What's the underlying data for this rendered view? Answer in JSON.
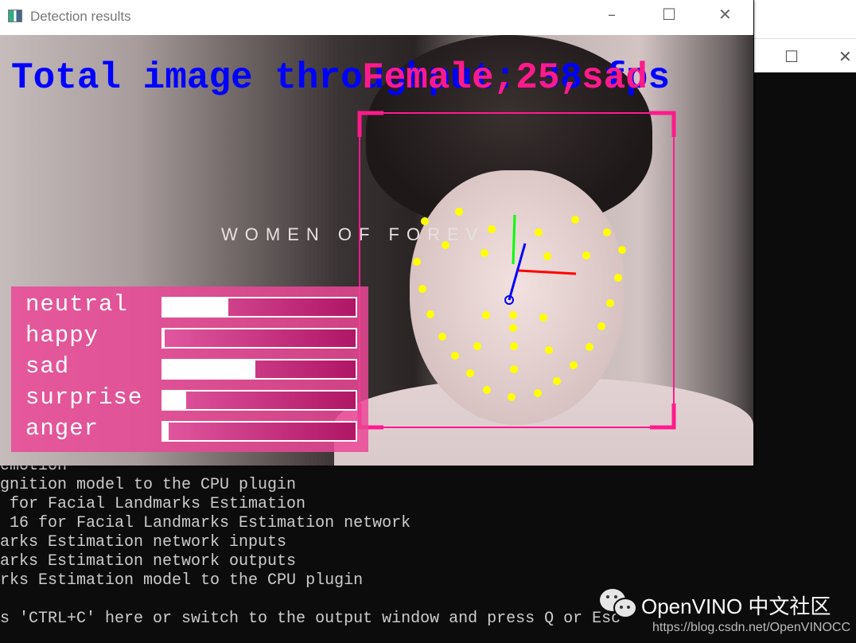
{
  "detection_window": {
    "title": "Detection results",
    "minimize": "–",
    "maximize": "☐",
    "close": "✕",
    "overlay_text": "Total image throughput: 38 fps",
    "face_label": "Female,25,sad",
    "scene_caption": "WOMEN OF FOREV",
    "emotions": [
      {
        "label": "neutral",
        "value": 0.34
      },
      {
        "label": "happy",
        "value": 0.01
      },
      {
        "label": "sad",
        "value": 0.48
      },
      {
        "label": "surprise",
        "value": 0.12
      },
      {
        "label": "anger",
        "value": 0.03
      }
    ],
    "colors": {
      "fps_text": "#0000ff",
      "face_box": "#ff1a8c",
      "landmarks": "#ffff00",
      "panel": "#eb4696"
    }
  },
  "console_window": {
    "maximize": "☐",
    "close": "✕",
    "lines": [
      "emotion",
      "gnition model to the CPU plugin",
      " for Facial Landmarks Estimation",
      " 16 for Facial Landmarks Estimation network",
      "arks Estimation network inputs",
      "arks Estimation network outputs",
      "rks Estimation model to the CPU plugin",
      "",
      "s 'CTRL+C' here or switch to the output window and press Q or Esc"
    ]
  },
  "watermark": {
    "name": "OpenVINO 中文社区",
    "url": "https://blog.csdn.net/OpenVINOCC",
    "icon": "wechat-icon"
  }
}
